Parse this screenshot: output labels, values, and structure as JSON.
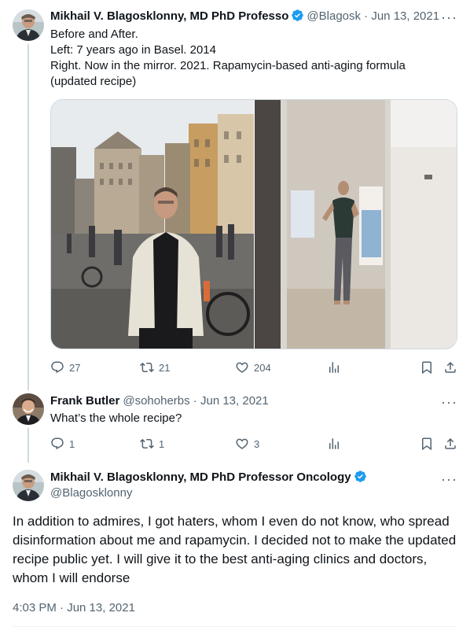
{
  "tweet1": {
    "name": "Mikhail V. Blagosklonny, MD PhD Professo",
    "handle": "@Blagosk",
    "sep": " · ",
    "date": "Jun 13, 2021",
    "lines": [
      "Before and After.",
      "Left: 7 years ago in Basel. 2014",
      "Right. Now in the mirror. 2021. Rapamycin-based anti-aging formula",
      "(updated recipe)"
    ],
    "replies": "27",
    "retweets": "21",
    "likes": "204"
  },
  "tweet2": {
    "name": "Frank Butler",
    "handle": "@sohoherbs",
    "sep": " · ",
    "date": "Jun 13, 2021",
    "text": "What’s the whole recipe?",
    "replies": "1",
    "retweets": "1",
    "likes": "3"
  },
  "tweet3": {
    "name": "Mikhail V. Blagosklonny, MD PhD Professor Oncology",
    "handle": "@Blagosklonny",
    "text": "In addition to admires, I got haters, whom I even do not know, who spread disinformation about me and rapamycin. I decided not to make the updated recipe public yet. I will give it to the best anti-aging clinics and doctors, whom I will endorse",
    "timestamp": "4:03 PM · Jun 13, 2021"
  },
  "icons": {
    "verified": "verified-badge-icon",
    "more": "more-icon",
    "reply": "reply-icon",
    "retweet": "retweet-icon",
    "like": "heart-icon",
    "views": "views-icon",
    "bookmark": "bookmark-icon",
    "share": "share-icon"
  },
  "colors": {
    "text": "#0f1419",
    "secondary": "#536471",
    "verified": "#1d9bf0",
    "line": "#cfd9de"
  }
}
